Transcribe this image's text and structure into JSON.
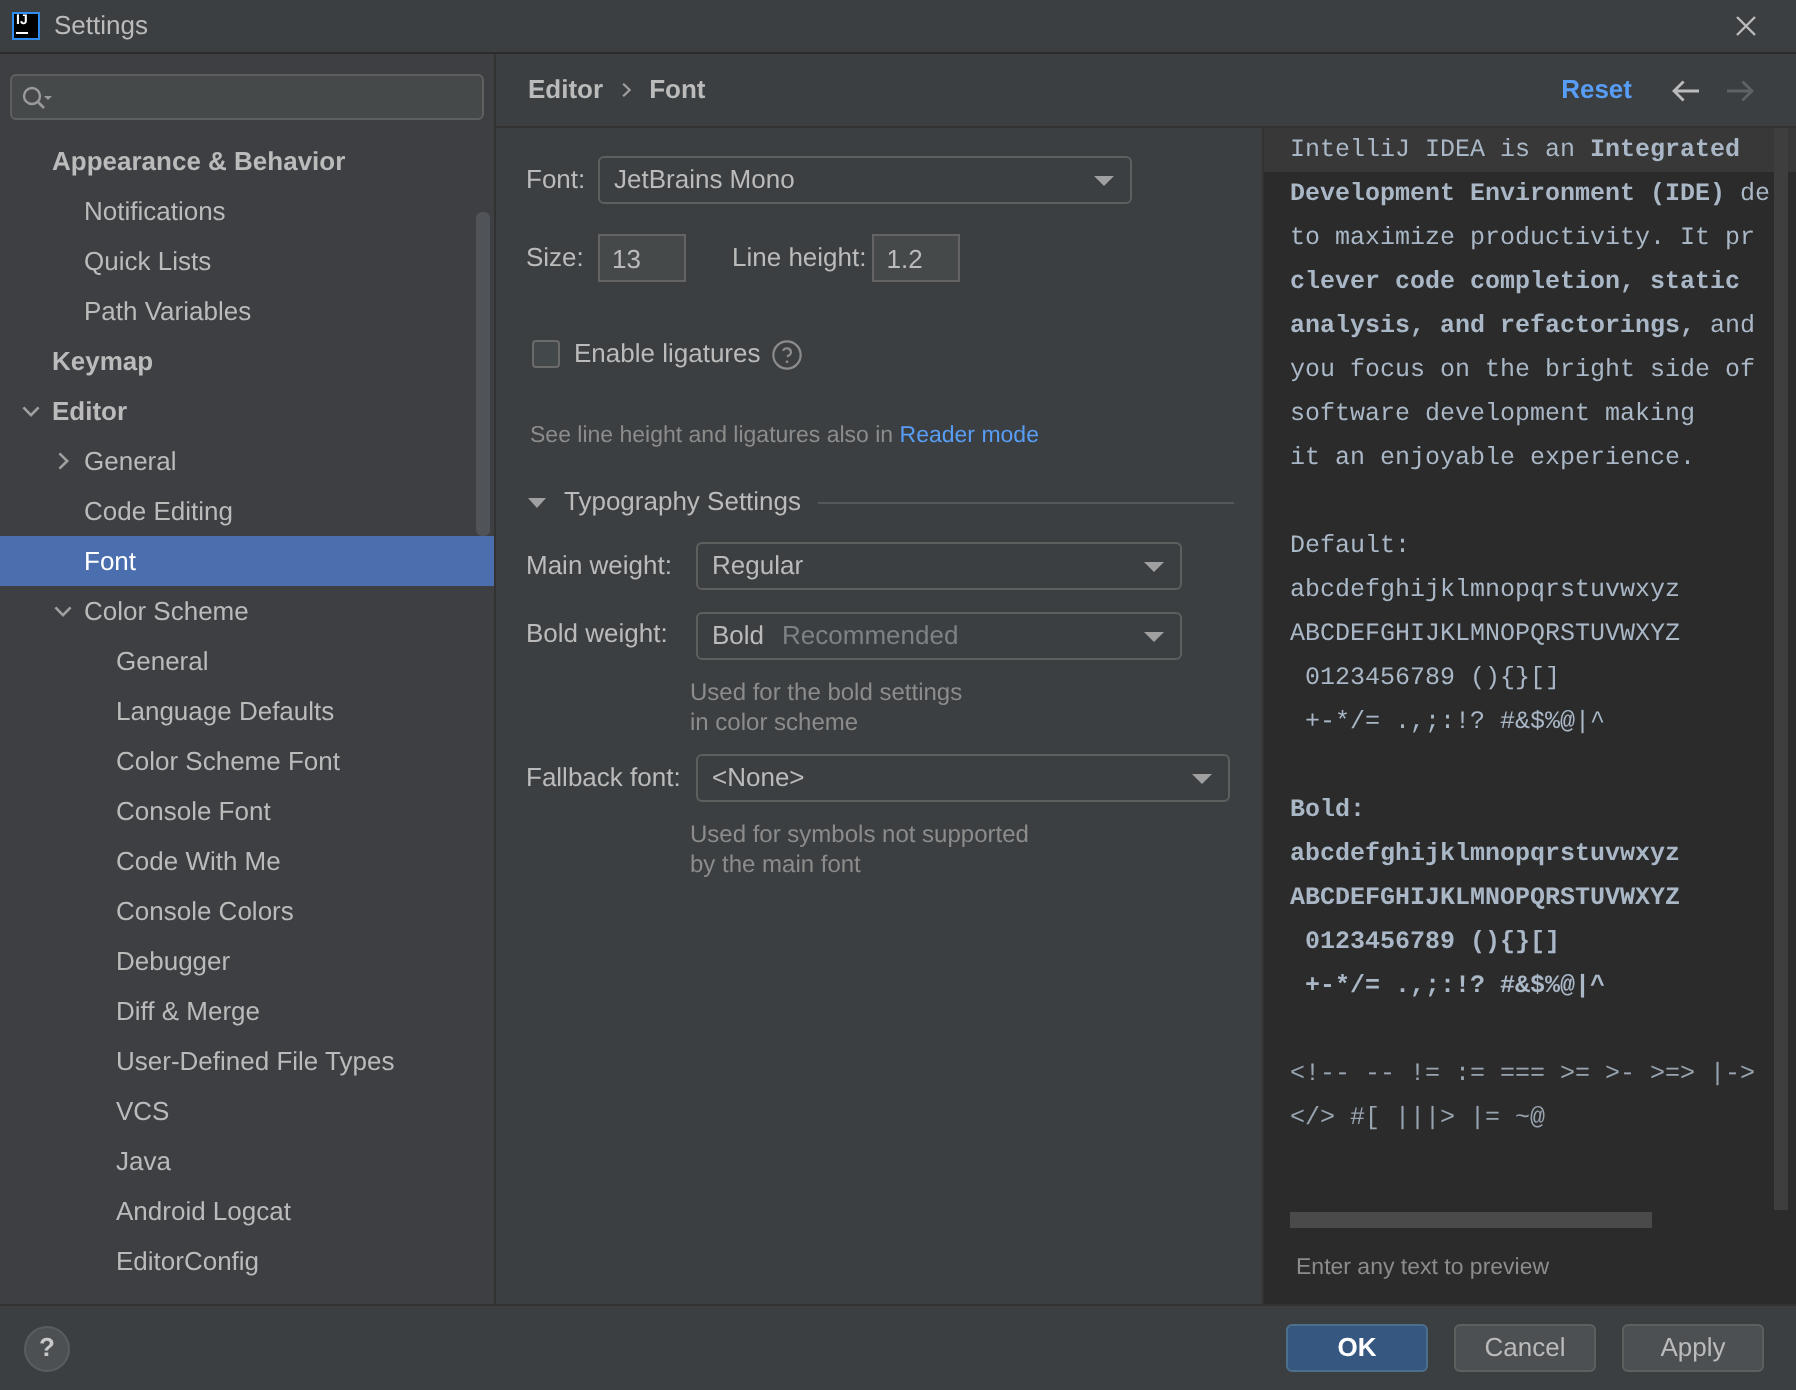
{
  "window": {
    "logo_text": "IJ",
    "title": "Settings"
  },
  "sidebar": {
    "items": [
      {
        "label": "Appearance & Behavior",
        "selected": false,
        "children": [
          {
            "label": "Notifications",
            "selected": false
          },
          {
            "label": "Quick Lists",
            "selected": false
          },
          {
            "label": "Path Variables",
            "selected": false
          }
        ]
      },
      {
        "label": "Keymap",
        "selected": false
      },
      {
        "label": "Editor",
        "selected": false,
        "expanded": true,
        "children": [
          {
            "label": "General",
            "selected": false,
            "expanded": false
          },
          {
            "label": "Code Editing",
            "selected": false
          },
          {
            "label": "Font",
            "selected": true
          },
          {
            "label": "Color Scheme",
            "selected": false,
            "expanded": true,
            "children": [
              {
                "label": "General",
                "selected": false
              },
              {
                "label": "Language Defaults",
                "selected": false
              },
              {
                "label": "Color Scheme Font",
                "selected": false
              },
              {
                "label": "Console Font",
                "selected": false
              },
              {
                "label": "Code With Me",
                "selected": false
              },
              {
                "label": "Console Colors",
                "selected": false
              },
              {
                "label": "Debugger",
                "selected": false
              },
              {
                "label": "Diff & Merge",
                "selected": false
              },
              {
                "label": "User-Defined File Types",
                "selected": false
              },
              {
                "label": "VCS",
                "selected": false
              },
              {
                "label": "Java",
                "selected": false
              },
              {
                "label": "Android Logcat",
                "selected": false
              },
              {
                "label": "EditorConfig",
                "selected": false
              }
            ]
          }
        ]
      }
    ]
  },
  "breadcrumb": [
    "Editor",
    "Font"
  ],
  "header_actions": {
    "reset": "Reset",
    "nav": [
      {
        "kind": "back",
        "disabled": false
      },
      {
        "kind": "forward",
        "disabled": true
      }
    ]
  },
  "font_settings": {
    "font": {
      "label": "Font:",
      "value": "JetBrains Mono"
    },
    "size": {
      "label": "Size:",
      "value": "13"
    },
    "line_height": {
      "label": "Line height:",
      "value": "1.2"
    },
    "ligatures": {
      "label": "Enable ligatures",
      "checked": false
    },
    "reader_note": {
      "text": "See line height and ligatures also in",
      "link": "Reader mode"
    }
  },
  "typography": {
    "title": "Typography Settings",
    "expanded": true,
    "main_weight": {
      "label": "Main weight:",
      "value": "Regular"
    },
    "bold_weight": {
      "label": "Bold weight:",
      "value": "Bold",
      "note": "Recommended",
      "hint": "Used for the bold settings\nin color scheme"
    },
    "fallback": {
      "label": "Fallback font:",
      "value": "<None>",
      "hint": "Used for symbols not supported\nby the main font"
    }
  },
  "preview": {
    "intro": [
      {
        "text": "IntelliJ IDEA is an **Integrated**",
        "current": true
      },
      {
        "text": "**Development Environment (IDE)** de",
        "current": false
      },
      {
        "text": "to maximize productivity. It pr",
        "current": false
      },
      {
        "text": "**clever code completion, static**",
        "current": false
      },
      {
        "text": "**analysis, and refactorings,** and",
        "current": false
      },
      {
        "text": "you focus on the bright side of",
        "current": false
      },
      {
        "text": "software development making",
        "current": false
      },
      {
        "text": "it an enjoyable experience.",
        "current": false
      }
    ],
    "samples": [
      {
        "heading": "Default:",
        "bold": false,
        "lines": [
          "abcdefghijklmnopqrstuvwxyz",
          "ABCDEFGHIJKLMNOPQRSTUVWXYZ",
          " 0123456789 (){}[]",
          " +-*/= .,;:!? #&$%@|^"
        ]
      },
      {
        "heading": "Bold:",
        "bold": true,
        "lines": [
          "abcdefghijklmnopqrstuvwxyz",
          "ABCDEFGHIJKLMNOPQRSTUVWXYZ",
          " 0123456789 (){}[]",
          " +-*/= .,;:!? #&$%@|^"
        ]
      }
    ],
    "ligatures": [
      "<!-- -- != := === >= >- >=> |->",
      "</> #[ |||> |= ~@"
    ],
    "hint": "Enter any text to preview"
  },
  "footer": {
    "help": "?",
    "buttons": [
      {
        "label": "OK",
        "kind": "default"
      },
      {
        "label": "Cancel",
        "kind": "normal"
      },
      {
        "label": "Apply",
        "kind": "normal"
      }
    ]
  }
}
